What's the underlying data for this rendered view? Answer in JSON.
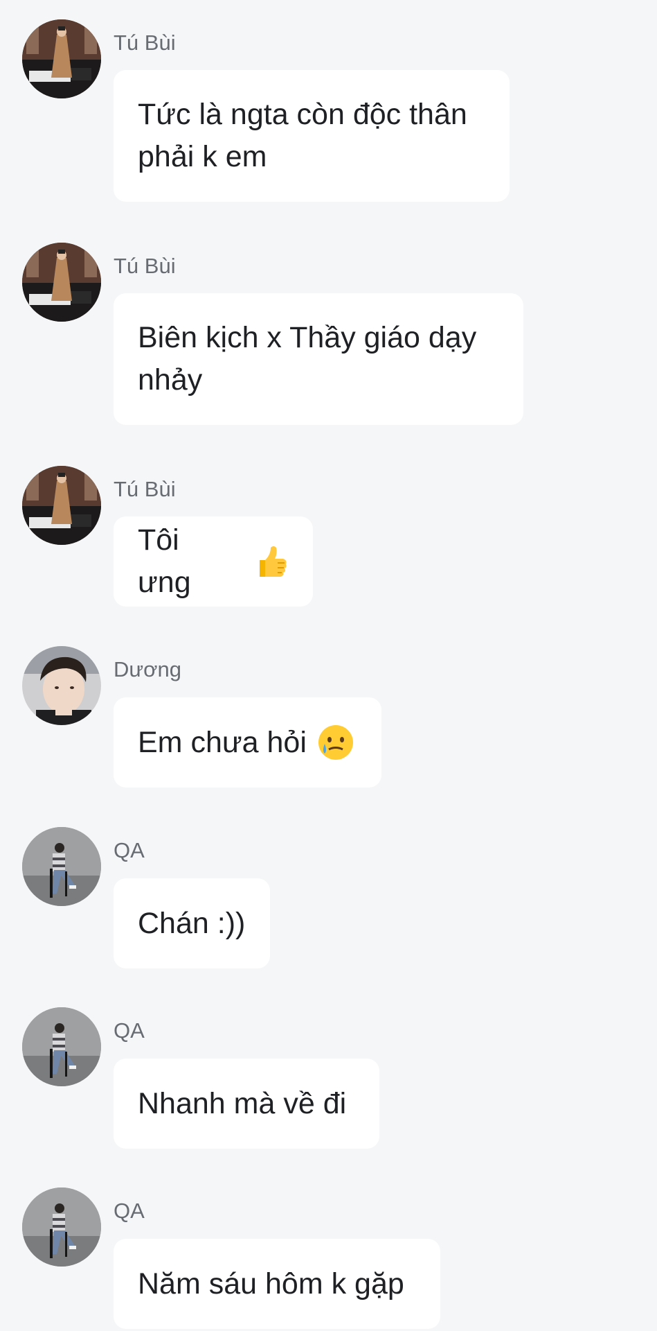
{
  "messages": [
    {
      "sender": "Tú Bùi",
      "text": "Tức là ngta còn độc thân phải k em",
      "avatar_icon": "man-in-trench-coat-photo",
      "emoji": ""
    },
    {
      "sender": "Tú Bùi",
      "text": "Biên kịch x Thầy giáo dạy nhảy",
      "avatar_icon": "man-in-trench-coat-photo",
      "emoji": ""
    },
    {
      "sender": "Tú Bùi",
      "text": "Tôi ưng",
      "avatar_icon": "man-in-trench-coat-photo",
      "emoji": "thumbs-up"
    },
    {
      "sender": "Dương",
      "text": "Em chưa hỏi",
      "avatar_icon": "young-man-portrait-photo",
      "emoji": "face-holding-back-tears"
    },
    {
      "sender": "QA",
      "text": "Chán :))",
      "avatar_icon": "seated-man-photo",
      "emoji": ""
    },
    {
      "sender": "QA",
      "text": "Nhanh mà về đi",
      "avatar_icon": "seated-man-photo",
      "emoji": ""
    },
    {
      "sender": "QA",
      "text": "Năm sáu hôm k gặp",
      "avatar_icon": "seated-man-photo",
      "emoji": ""
    }
  ],
  "colors": {
    "background": "#f5f6f8",
    "bubble": "#ffffff",
    "sender_text": "#676b72",
    "message_text": "#1e2024"
  }
}
